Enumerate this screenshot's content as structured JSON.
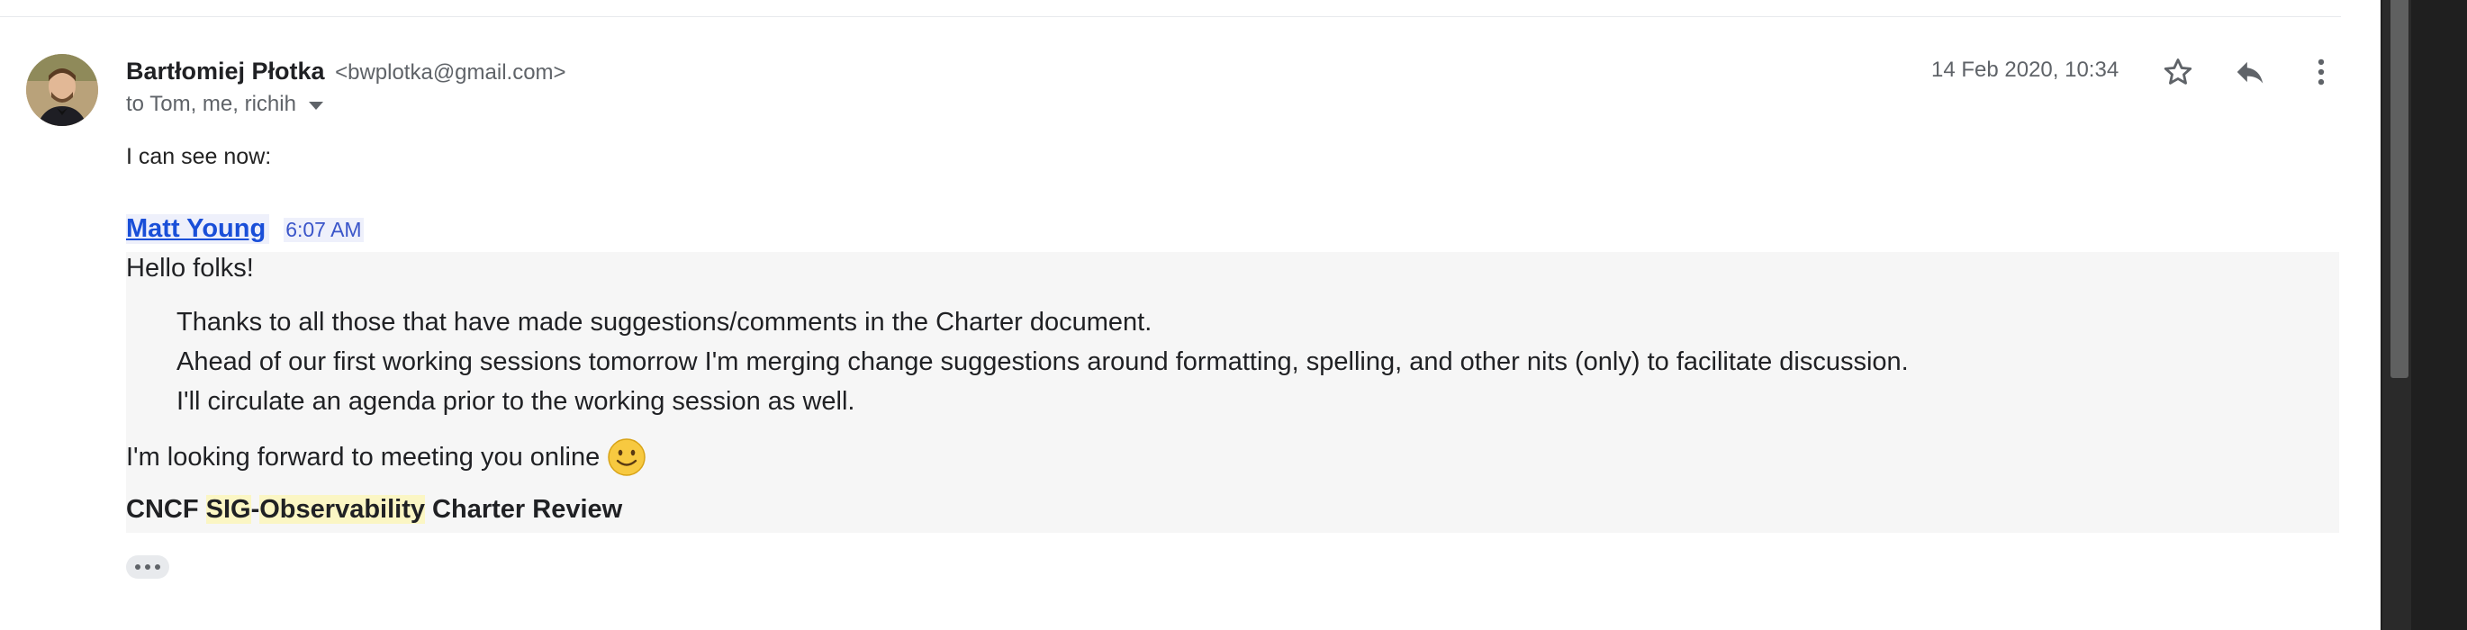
{
  "message": {
    "sender_name": "Bartłomiej Płotka",
    "sender_email": "<bwplotka@gmail.com>",
    "recipients": "to Tom, me, richih",
    "timestamp": "14 Feb 2020, 10:34",
    "intro_text": "I can see now:"
  },
  "quoted": {
    "author": "Matt Young",
    "time": "6:07 AM",
    "greeting": "Hello folks!",
    "paragraphs": [
      "Thanks to all those that have made suggestions/comments in the Charter document.",
      "Ahead of our first working sessions tomorrow I'm merging change suggestions around formatting, spelling, and other nits (only) to facilitate discussion.",
      "I'll circulate an agenda prior to the working session as well."
    ],
    "closing": "I'm looking forward to meeting you online",
    "title_parts": {
      "pre": "CNCF ",
      "hl1": "SIG",
      "dash": "-",
      "hl2": "Observability",
      "post": " Charter Review"
    }
  },
  "icons": {
    "star": "star-icon",
    "reply": "reply-icon",
    "more": "more-vert-icon",
    "smiley": "smiley-emoji-icon",
    "ellipsis": "show-trimmed-content-icon"
  },
  "colors": {
    "link_blue": "#1a4fd8",
    "quoted_bg": "#f6f6f6",
    "highlight": "#fbf6c4",
    "muted_text": "#5f6368"
  }
}
